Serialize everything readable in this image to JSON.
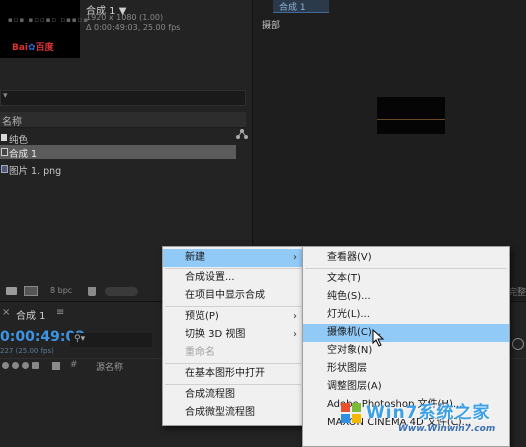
{
  "project_panel": {
    "comp_title": "合成 1 ▼",
    "comp_dimensions": "1920 x 1080 (1.00)",
    "comp_duration": "Δ 0:00:49:03, 25.00 fps",
    "thumbnail_logo_text": "Bai",
    "thumbnail_logo_suffix": "百度",
    "header_label": "名称",
    "items": [
      {
        "label": "纯色",
        "icon": "solid-icon"
      },
      {
        "label": "合成 1",
        "icon": "composition-icon",
        "selected": true
      },
      {
        "label": "图片 1. png",
        "icon": "image-file-icon"
      }
    ],
    "bpc_label": "8 bpc"
  },
  "comp_panel": {
    "tab_label": "合成 1",
    "active_camera_label": "摄部"
  },
  "right_edge_label": "完整",
  "timeline": {
    "tab_label": "合成 1",
    "timecode": "0:00:49:02",
    "frame_info": "227 (25.00 fps)",
    "source_name_header": "源名称",
    "hash_header": "#"
  },
  "context_menu": {
    "items": [
      {
        "label": "新建",
        "submenu": true,
        "highlighted": true
      },
      {
        "label": "合成设置..."
      },
      {
        "label": "在项目中显示合成"
      },
      {
        "label": "预览(P)",
        "submenu": true
      },
      {
        "label": "切换 3D 视图",
        "submenu": true
      },
      {
        "label": "重命名",
        "disabled": true
      },
      {
        "label": "在基本图形中打开"
      },
      {
        "label": "合成流程图"
      },
      {
        "label": "合成微型流程图"
      }
    ]
  },
  "new_submenu": {
    "items": [
      {
        "label": "查看器(V)"
      },
      {
        "label": "文本(T)"
      },
      {
        "label": "纯色(S)..."
      },
      {
        "label": "灯光(L)..."
      },
      {
        "label": "摄像机(C)...",
        "highlighted": true
      },
      {
        "label": "空对象(N)"
      },
      {
        "label": "形状图层"
      },
      {
        "label": "调整图层(A)"
      },
      {
        "label": "Adobe Photoshop 文件(H)..."
      },
      {
        "label": "MAXON CINEMA 4D 文件(C)..."
      }
    ]
  },
  "watermark": {
    "text": "Win7系统之家",
    "url": "Www.Winwin7.com"
  },
  "colors": {
    "timecode": "#3d95e6",
    "menu_bg": "#f0f0f0",
    "menu_highlight": "#91c9f7"
  }
}
